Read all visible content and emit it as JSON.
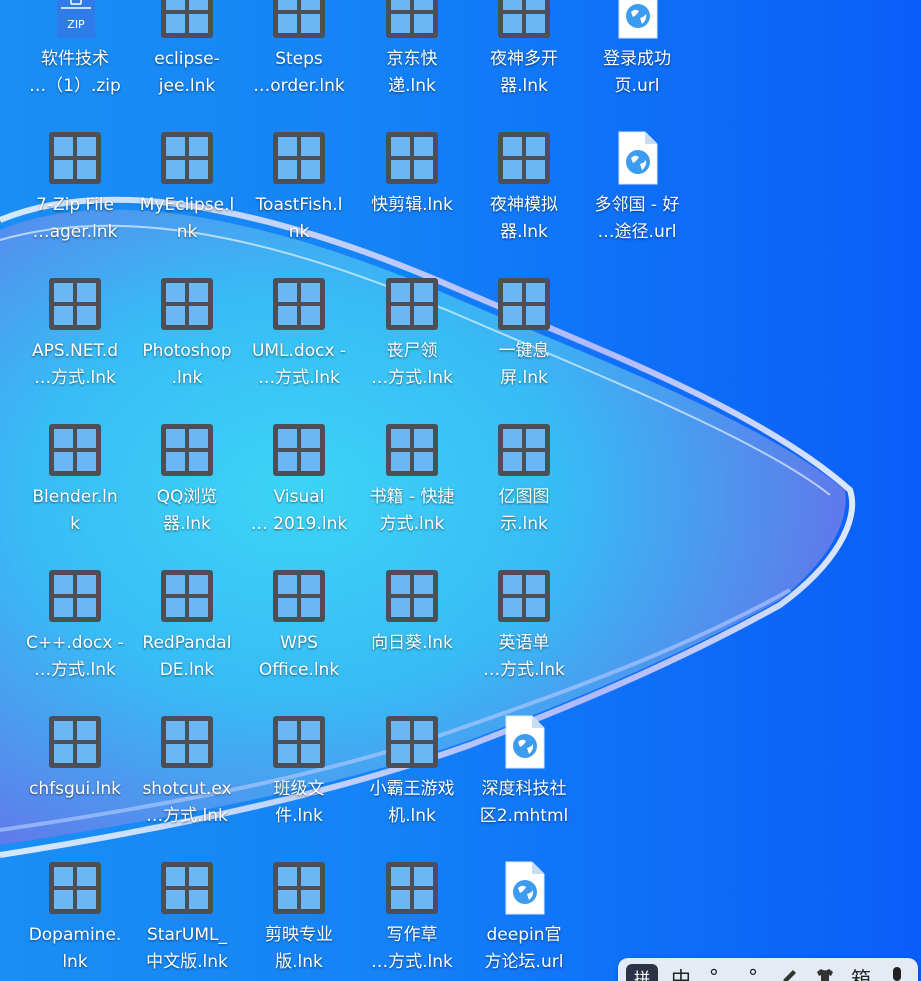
{
  "colors": {
    "tile_frame": "#4d4f56",
    "tile_fill": "#6bb6f4",
    "url_icon": "#3c9cf0",
    "label_text": "#ffffff"
  },
  "desktop_icons": [
    {
      "label": "软件技术\n…（1）.zip",
      "icon": "zip-file-icon"
    },
    {
      "label": "eclipse-\njee.lnk",
      "icon": "app-shortcut-icon"
    },
    {
      "label": "Steps\n…order.lnk",
      "icon": "app-shortcut-icon"
    },
    {
      "label": "京东快\n递.lnk",
      "icon": "app-shortcut-icon"
    },
    {
      "label": "夜神多开\n器.lnk",
      "icon": "app-shortcut-icon"
    },
    {
      "label": "登录成功\n页.url",
      "icon": "web-link-icon"
    },
    {
      "label": "7-Zip File\n…ager.lnk",
      "icon": "app-shortcut-icon"
    },
    {
      "label": "MyEclipse.l\nnk",
      "icon": "app-shortcut-icon"
    },
    {
      "label": "ToastFish.l\nnk",
      "icon": "app-shortcut-icon"
    },
    {
      "label": "快剪辑.lnk",
      "icon": "app-shortcut-icon"
    },
    {
      "label": "夜神模拟\n器.lnk",
      "icon": "app-shortcut-icon"
    },
    {
      "label": "多邻国 - 好\n…途径.url",
      "icon": "web-link-icon"
    },
    {
      "label": "APS.NET.d\n…方式.lnk",
      "icon": "app-shortcut-icon"
    },
    {
      "label": "Photoshop\n.lnk",
      "icon": "app-shortcut-icon"
    },
    {
      "label": "UML.docx -\n…方式.lnk",
      "icon": "app-shortcut-icon"
    },
    {
      "label": "丧尸领\n…方式.lnk",
      "icon": "app-shortcut-icon"
    },
    {
      "label": "一键息\n屏.lnk",
      "icon": "app-shortcut-icon"
    },
    {
      "label": "Blender.ln\nk",
      "icon": "app-shortcut-icon"
    },
    {
      "label": "QQ浏览\n器.lnk",
      "icon": "app-shortcut-icon"
    },
    {
      "label": "Visual\n… 2019.lnk",
      "icon": "app-shortcut-icon"
    },
    {
      "label": "书籍 - 快捷\n方式.lnk",
      "icon": "app-shortcut-icon"
    },
    {
      "label": "亿图图\n示.lnk",
      "icon": "app-shortcut-icon"
    },
    {
      "label": "C++.docx -\n…方式.lnk",
      "icon": "app-shortcut-icon"
    },
    {
      "label": "RedPandaI\nDE.lnk",
      "icon": "app-shortcut-icon"
    },
    {
      "label": "WPS\nOffice.lnk",
      "icon": "app-shortcut-icon"
    },
    {
      "label": "向日葵.lnk",
      "icon": "app-shortcut-icon"
    },
    {
      "label": "英语单\n…方式.lnk",
      "icon": "app-shortcut-icon"
    },
    {
      "label": "chfsgui.lnk",
      "icon": "app-shortcut-icon"
    },
    {
      "label": "shotcut.ex\n…方式.lnk",
      "icon": "app-shortcut-icon"
    },
    {
      "label": "班级文\n件.lnk",
      "icon": "app-shortcut-icon"
    },
    {
      "label": "小霸王游戏\n机.lnk",
      "icon": "app-shortcut-icon"
    },
    {
      "label": "深度科技社\n区2.mhtml",
      "icon": "web-link-icon"
    },
    {
      "label": "Dopamine.\nlnk",
      "icon": "app-shortcut-icon"
    },
    {
      "label": "StarUML_\n中文版.lnk",
      "icon": "app-shortcut-icon"
    },
    {
      "label": "剪映专业\n版.lnk",
      "icon": "app-shortcut-icon"
    },
    {
      "label": "写作草\n…方式.lnk",
      "icon": "app-shortcut-icon"
    },
    {
      "label": "deepin官\n方论坛.url",
      "icon": "web-link-icon"
    }
  ],
  "ime_toolbar": {
    "logo": "拼",
    "mode": "中",
    "punct": "°,",
    "pinyin": "°",
    "handwriting_icon": "pen-icon",
    "skin_icon": "shirt-icon",
    "toolbox": "箱",
    "more_icon": "mic-icon"
  }
}
